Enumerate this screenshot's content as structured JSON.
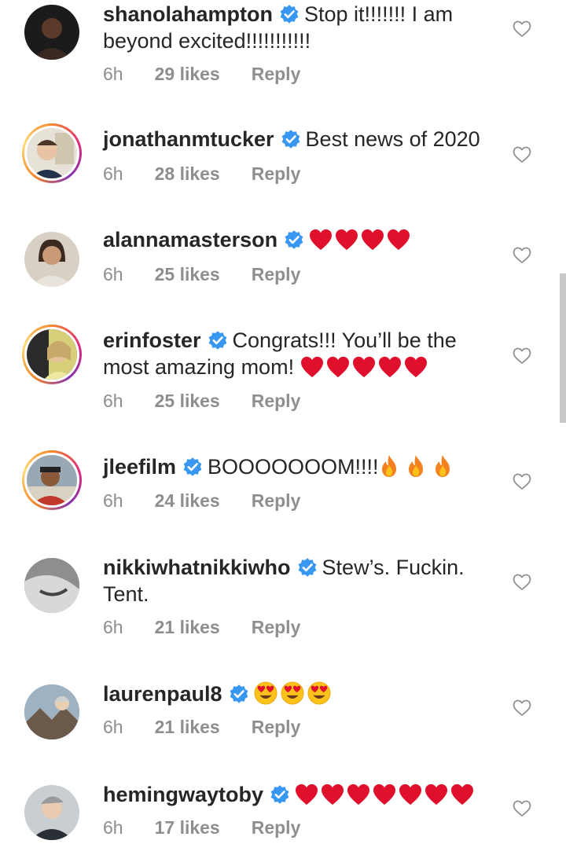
{
  "comments": [
    {
      "username": "shanolahampton",
      "text": "Stop it!!!!!!! I am beyond excited!!!!!!!!!!!",
      "time": "6h",
      "likes": "29 likes",
      "reply": "Reply",
      "avatar_color": "#1b1b1b",
      "story": false
    },
    {
      "username": "jonathanmtucker",
      "text": "Best news of 2020",
      "time": "6h",
      "likes": "28 likes",
      "reply": "Reply",
      "avatar_color": "#7a8a9a",
      "story": true
    },
    {
      "username": "alannamasterson",
      "text": "",
      "emoji": "heart-emoji x4",
      "time": "6h",
      "likes": "25 likes",
      "reply": "Reply",
      "avatar_color": "#b58b6c",
      "story": false
    },
    {
      "username": "erinfoster",
      "text": "Congrats!!! You’ll be the most amazing mom!",
      "emoji": "heart-emoji x5",
      "time": "6h",
      "likes": "25 likes",
      "reply": "Reply",
      "avatar_color": "#c8b85a",
      "story": true
    },
    {
      "username": "jleefilm",
      "text": "BOOOOOOOM!!!!",
      "emoji": "fire-emoji x3",
      "time": "6h",
      "likes": "24 likes",
      "reply": "Reply",
      "avatar_color": "#8a5a3a",
      "story": true
    },
    {
      "username": "nikkiwhatnikkiwho",
      "text": "Stew’s. Fuckin. Tent.",
      "time": "6h",
      "likes": "21 likes",
      "reply": "Reply",
      "avatar_color": "#9a9a9a",
      "story": false
    },
    {
      "username": "laurenpaul8",
      "text": "",
      "emoji": "heart-eyes-emoji x3",
      "time": "6h",
      "likes": "21 likes",
      "reply": "Reply",
      "avatar_color": "#6d7e8e",
      "story": false
    },
    {
      "username": "hemingwaytoby",
      "text": "",
      "emoji": "heart-emoji x7",
      "time": "6h",
      "likes": "17 likes",
      "reply": "Reply",
      "avatar_color": "#4e5a64",
      "story": false
    }
  ],
  "colors": {
    "verified": "#3897f0",
    "heart_emoji": "#e0102c",
    "meta": "#8e8e8e",
    "text": "#262626"
  }
}
